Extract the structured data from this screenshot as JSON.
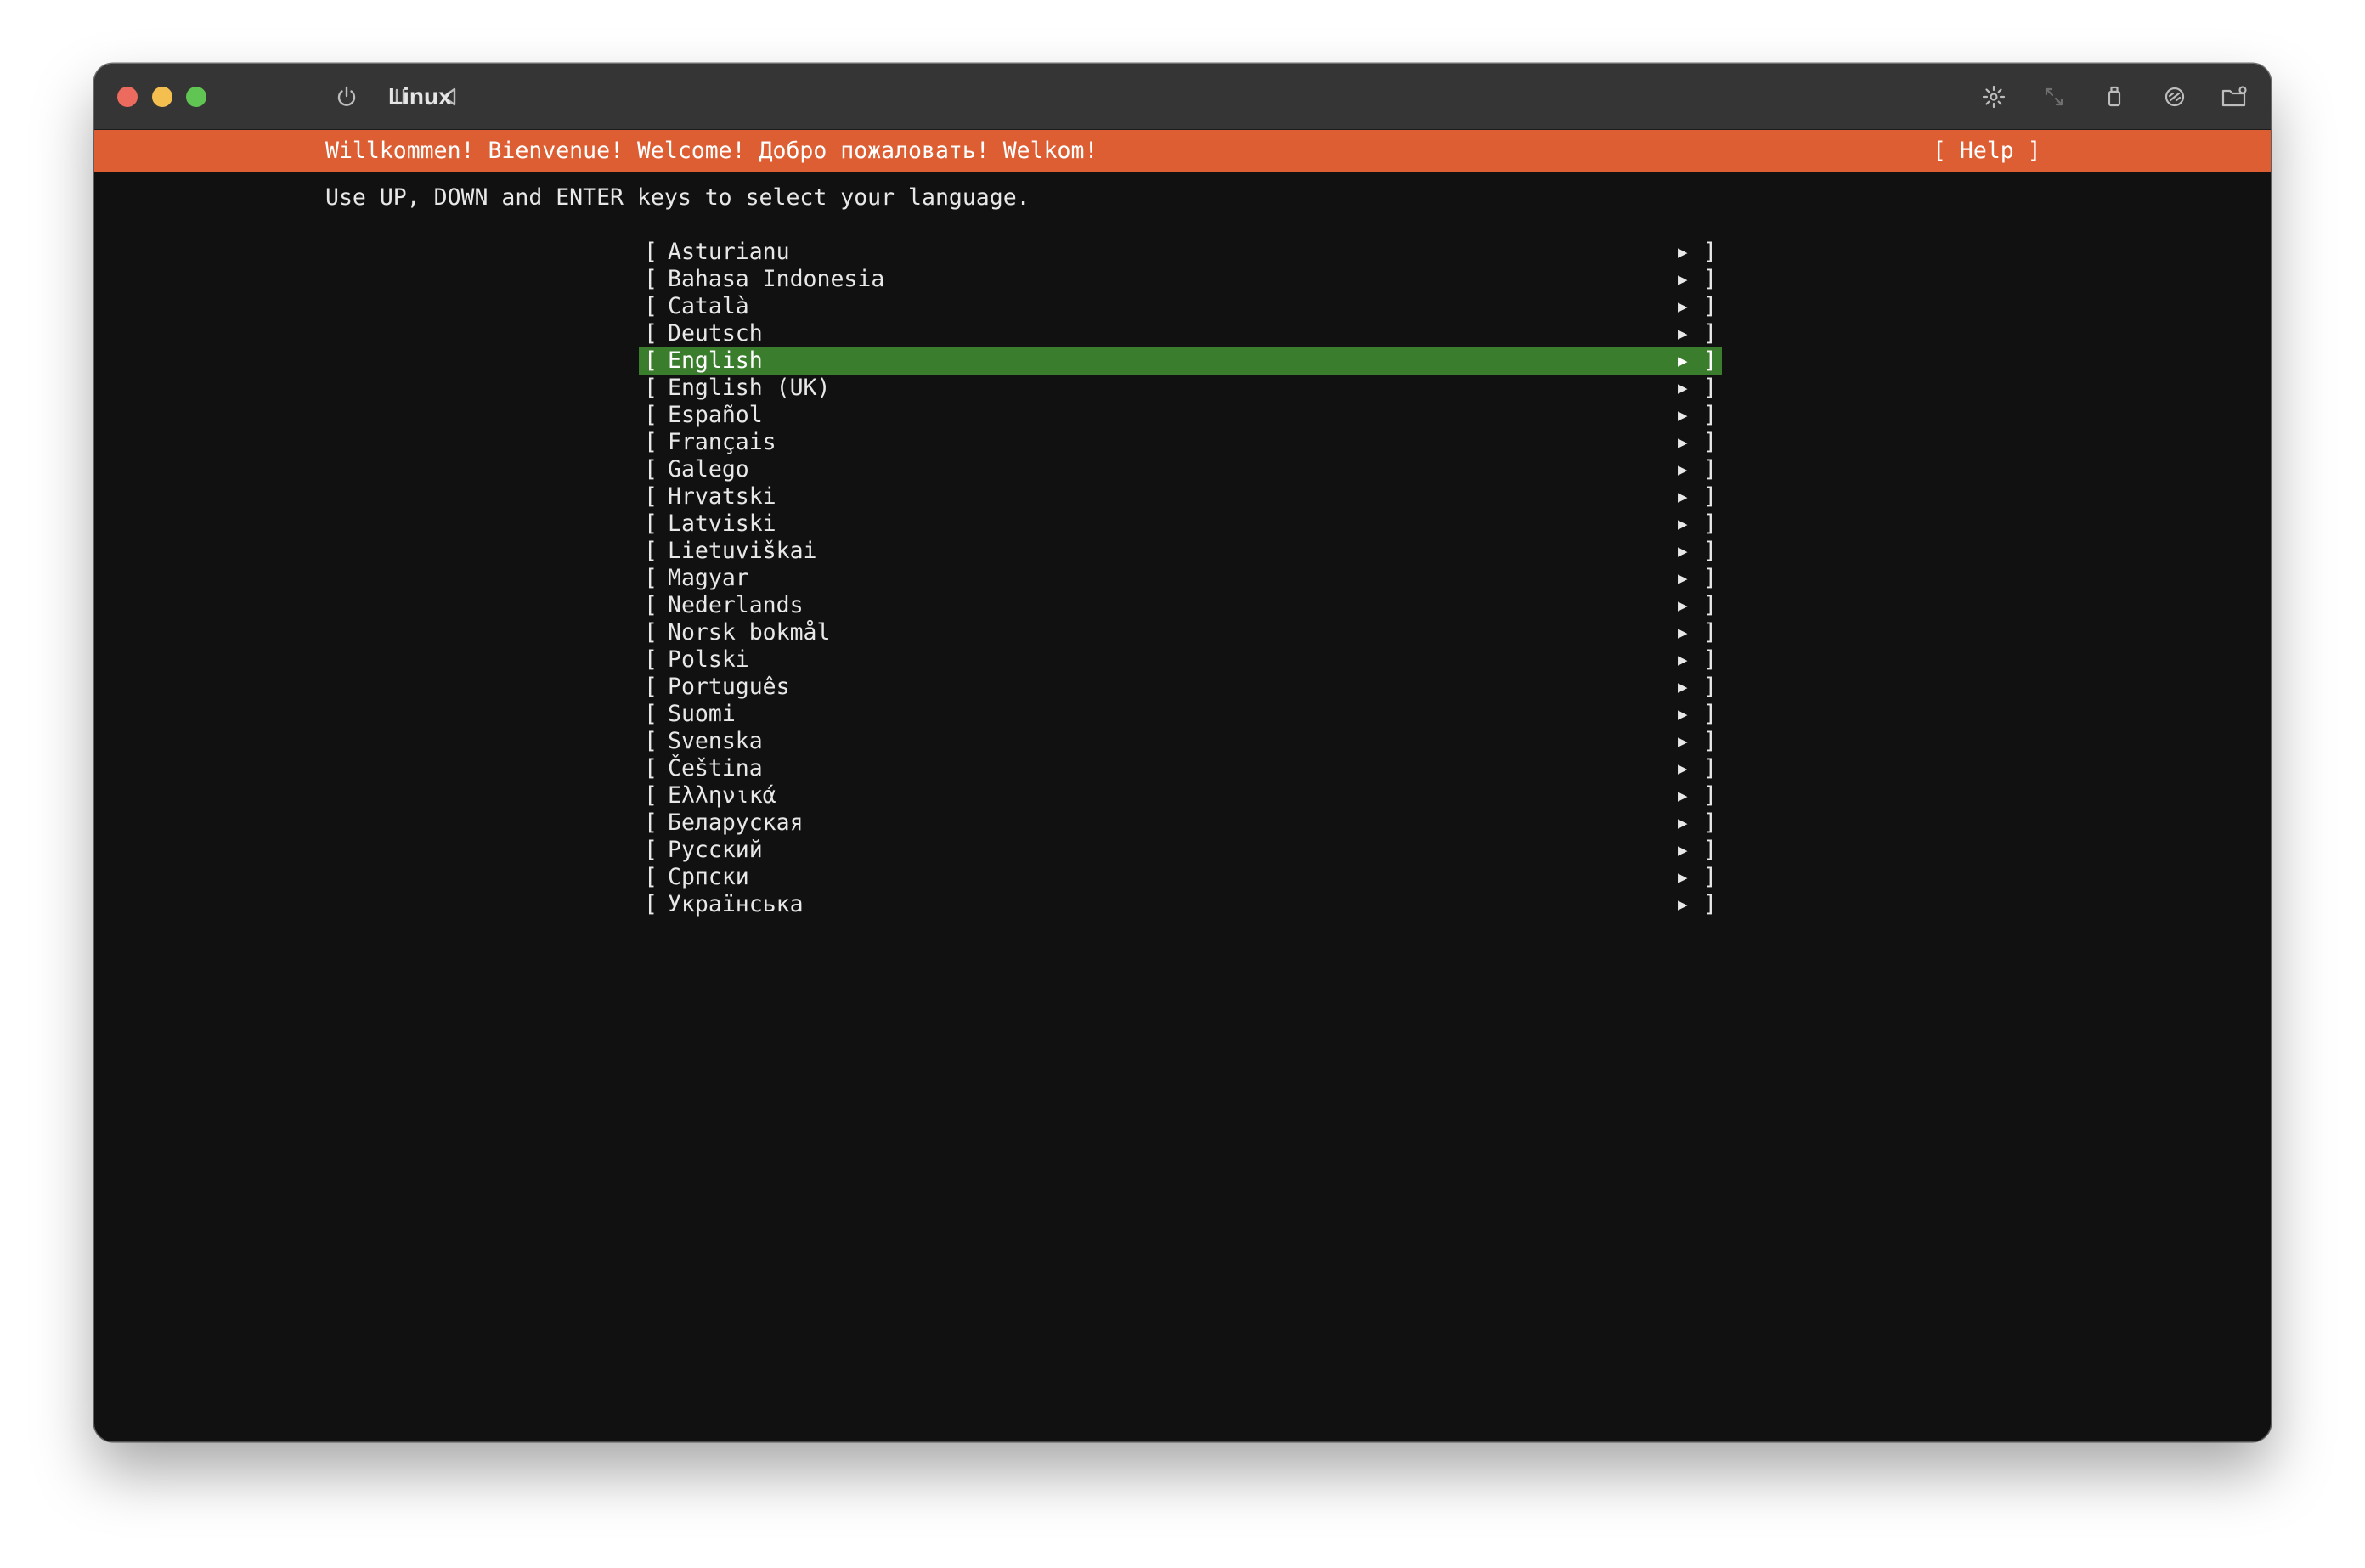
{
  "window": {
    "title": "Linux",
    "toolbar_icons": [
      "power-icon",
      "pause-icon",
      "back-icon",
      "brightness-icon",
      "resize-icon",
      "usb-icon",
      "shared-folder-icon",
      "folder-settings-icon"
    ]
  },
  "installer": {
    "banner": "Willkommen! Bienvenue! Welcome! Добро пожаловать! Welkom!",
    "help_label": "[ Help ]",
    "instruction": "Use UP, DOWN and ENTER keys to select your language.",
    "bracket_open": "[",
    "bracket_close": "]",
    "arrow_glyph": "▶",
    "selected_index": 4,
    "highlight_color": "#3a7d2c",
    "banner_color": "#dd5e33",
    "languages": [
      "Asturianu",
      "Bahasa Indonesia",
      "Català",
      "Deutsch",
      "English",
      "English (UK)",
      "Español",
      "Français",
      "Galego",
      "Hrvatski",
      "Latviski",
      "Lietuviškai",
      "Magyar",
      "Nederlands",
      "Norsk bokmål",
      "Polski",
      "Português",
      "Suomi",
      "Svenska",
      "Čeština",
      "Ελληνικά",
      "Беларуская",
      "Русский",
      "Српски",
      "Українська"
    ]
  }
}
